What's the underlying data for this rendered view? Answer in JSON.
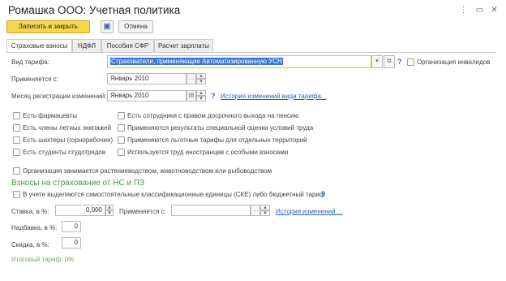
{
  "window": {
    "title": "Ромашка ООО: Учетная политика",
    "more_icon": "⋮",
    "restore_icon": "▭",
    "close_icon": "✕"
  },
  "toolbar": {
    "save_close_label": "Записать и закрыть",
    "save_icon": "▣",
    "cancel_label": "Отмена"
  },
  "tabs": [
    {
      "label": "Страховые взносы",
      "active": true
    },
    {
      "label": "НДФЛ",
      "active": false
    },
    {
      "label": "Пособия СФР",
      "active": false
    },
    {
      "label": "Расчет зарплаты",
      "active": false
    }
  ],
  "form": {
    "tariff_label": "Вид тарифа:",
    "tariff_value": "Страхователи, применяющие Автоматизированную УСН",
    "tariff_dropdown_icon": "▾",
    "tariff_open_icon": "⧉",
    "q_icon": "?",
    "disabled_org_label": "Организация инвалидов",
    "applies_label": "Применяется с:",
    "applies_value": "Январь 2010",
    "applies_dots": "...",
    "reg_month_label": "Месяц регистрации изменений:",
    "reg_month_value": "Январь 2010",
    "calendar_icon": "▤",
    "spin_up": "▴",
    "spin_down": "▾",
    "history_tariff_link": "История изменений вида тарифа..."
  },
  "checkboxes_left": [
    "Есть фармацевты",
    "Есть члены летных экипажей",
    "Есть шахтеры (горнорабочие)",
    "Есть студенты студотрядов"
  ],
  "checkboxes_right": [
    "Есть сотрудники с правом досрочного выхода на пенсию",
    "Применяются результаты специальной оценки условий труда",
    "Применяются льготные тарифы для отдельных территорий",
    "Используется труд иностранцев с особыми взносами"
  ],
  "agri_label": "Организация занимается растениеводством, животноводством или рыбоводством",
  "ns_section": {
    "title": "Взносы на страхование от НС и ПЗ",
    "ske_label": "В учете выделяются самостоятельные классификационные единицы (СКЕ) либо бюджетный тариф",
    "rate_label": "Ставка, в %:",
    "rate_value": "0,000",
    "rate_applies_label": "Применяется с:",
    "rate_applies_value": "",
    "history_link": "История изменений....",
    "surcharge_label": "Надбавка, в %:",
    "surcharge_value": "0",
    "discount_label": "Скидка, в %:",
    "discount_value": "0",
    "total_hint": "Итоговый тариф: 0%."
  }
}
